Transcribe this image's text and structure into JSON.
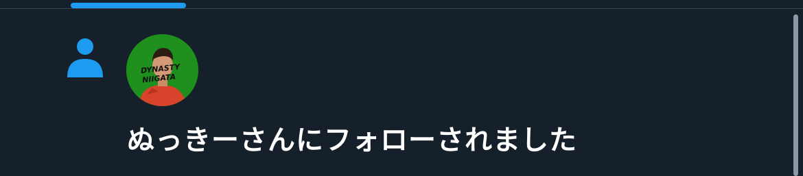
{
  "notification": {
    "type_icon": "person-icon",
    "avatar_label": "avatar",
    "avatar_logo_lines": [
      "DYNASTY",
      "NIIGATA"
    ],
    "text": "ぬっきーさんにフォローされました"
  },
  "colors": {
    "background": "#15202b",
    "accent": "#1d9bf0",
    "divider": "#38444d",
    "text": "#ffffff",
    "avatar_bg": "#1f8f1d"
  }
}
